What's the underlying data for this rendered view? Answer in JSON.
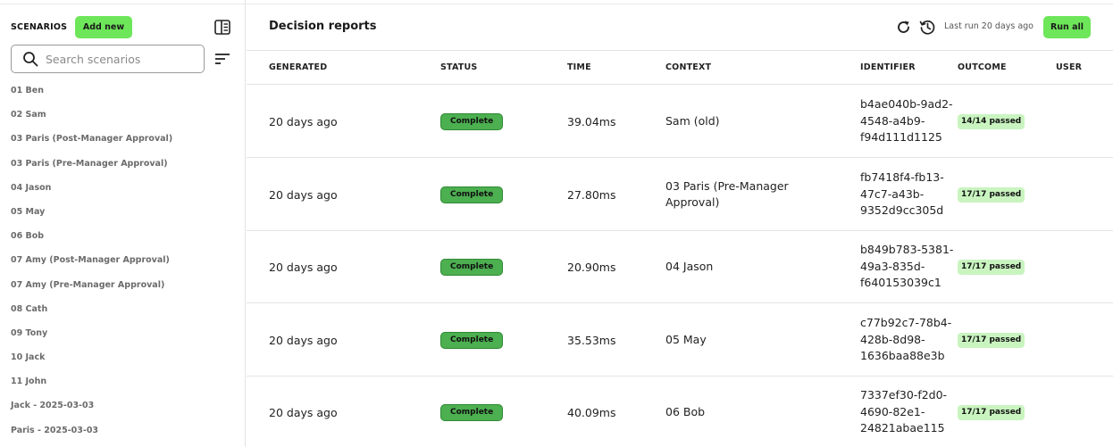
{
  "sidebar": {
    "title": "SCENARIOS",
    "add_label": "Add new",
    "search_placeholder": "Search scenarios",
    "items": [
      "01 Ben",
      "02 Sam",
      "03 Paris (Post-Manager Approval)",
      "03 Paris (Pre-Manager Approval)",
      "04 Jason",
      "05 May",
      "06 Bob",
      "07 Amy (Post-Manager Approval)",
      "07 Amy (Pre-Manager Approval)",
      "08 Cath",
      "09 Tony",
      "10 Jack",
      "11 John",
      "Jack - 2025-03-03",
      "Paris - 2025-03-03"
    ]
  },
  "header": {
    "title": "Decision reports",
    "last_run": "Last run 20 days ago",
    "run_all_label": "Run all",
    "icons": [
      "refresh-icon",
      "history-icon"
    ]
  },
  "table": {
    "columns": [
      "GENERATED",
      "STATUS",
      "TIME",
      "CONTEXT",
      "IDENTIFIER",
      "OUTCOME",
      "USER"
    ],
    "rows": [
      {
        "generated": "20 days ago",
        "status": "Complete",
        "time": "39.04ms",
        "context": "Sam (old)",
        "identifier": [
          "b4ae040b-9ad2-",
          "4548-a4b9-",
          "f94d111d1125"
        ],
        "outcome": "14/14 passed",
        "user": ""
      },
      {
        "generated": "20 days ago",
        "status": "Complete",
        "time": "27.80ms",
        "context": [
          "03 Paris (Pre-Manager",
          "Approval)"
        ],
        "identifier": [
          "fb7418f4-fb13-",
          "47c7-a43b-",
          "9352d9cc305d"
        ],
        "outcome": "17/17 passed",
        "user": ""
      },
      {
        "generated": "20 days ago",
        "status": "Complete",
        "time": "20.90ms",
        "context": "04 Jason",
        "identifier": [
          "b849b783-5381-",
          "49a3-835d-",
          "f640153039c1"
        ],
        "outcome": "17/17 passed",
        "user": ""
      },
      {
        "generated": "20 days ago",
        "status": "Complete",
        "time": "35.53ms",
        "context": "05 May",
        "identifier": [
          "c77b92c7-78b4-",
          "428b-8d98-",
          "1636baa88e3b"
        ],
        "outcome": "17/17 passed",
        "user": ""
      },
      {
        "generated": "20 days ago",
        "status": "Complete",
        "time": "40.09ms",
        "context": "06 Bob",
        "identifier": [
          "7337ef30-f2d0-",
          "4690-82e1-",
          "24821abae115"
        ],
        "outcome": "17/17 passed",
        "user": ""
      }
    ]
  },
  "colors": {
    "accent_button": "#6ee65a",
    "status_complete": "#4caf50",
    "outcome_bg": "#c9f4c0"
  }
}
